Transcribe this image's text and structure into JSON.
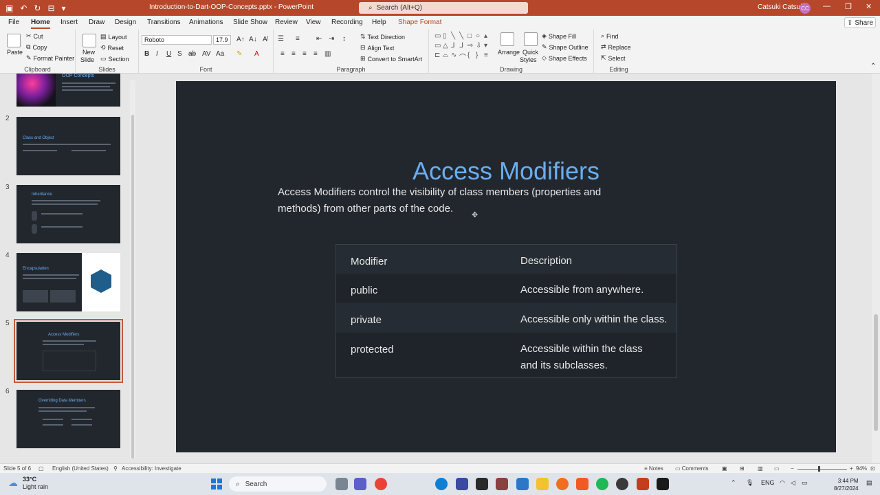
{
  "window": {
    "file_title": "Introduction-to-Dart-OOP-Concepts.pptx",
    "app_name": "PowerPoint",
    "search_placeholder": "Search (Alt+Q)",
    "user_name": "Catsuki Catsuki",
    "user_initials": "CC",
    "accent_color": "#b7472a"
  },
  "tabs": [
    "File",
    "Home",
    "Insert",
    "Draw",
    "Design",
    "Transitions",
    "Animations",
    "Slide Show",
    "Review",
    "View",
    "Recording",
    "Help",
    "Shape Format"
  ],
  "active_tab": "Home",
  "share_label": "Share",
  "ribbon": {
    "clipboard": {
      "label": "Clipboard",
      "paste": "Paste",
      "cut": "Cut",
      "copy": "Copy",
      "format_painter": "Format Painter"
    },
    "slides": {
      "label": "Slides",
      "new_slide": "New",
      "new_slide2": "Slide",
      "layout": "Layout",
      "reset": "Reset",
      "section": "Section"
    },
    "font": {
      "label": "Font",
      "font_name": "Roboto",
      "font_size": "17.9"
    },
    "paragraph": {
      "label": "Paragraph",
      "text_direction": "Text Direction",
      "align_text": "Align Text",
      "convert_smartart": "Convert to SmartArt"
    },
    "drawing": {
      "label": "Drawing",
      "arrange": "Arrange",
      "quick_styles": "Quick",
      "quick_styles2": "Styles",
      "shape_fill": "Shape Fill",
      "shape_outline": "Shape Outline",
      "shape_effects": "Shape Effects"
    },
    "editing": {
      "label": "Editing",
      "find": "Find",
      "replace": "Replace",
      "select": "Select"
    }
  },
  "thumbnails": [
    {
      "num": "",
      "title": "OOP Concepts"
    },
    {
      "num": "2",
      "title": "Class and Object"
    },
    {
      "num": "3",
      "title": "Inheritance"
    },
    {
      "num": "4",
      "title": "Encapsulation"
    },
    {
      "num": "5",
      "title": "Access Modifiers"
    },
    {
      "num": "6",
      "title": "Overriding Data Members"
    }
  ],
  "slide": {
    "title": "Access Modifiers",
    "body": "Access Modifiers control the visibility of class members (properties and methods) from other parts of the code.",
    "table": {
      "headers": [
        "Modifier",
        "Description"
      ],
      "rows": [
        [
          "public",
          "Accessible from anywhere."
        ],
        [
          "private",
          "Accessible only within the class."
        ],
        [
          "protected",
          "Accessible within the class and its subclasses."
        ]
      ]
    }
  },
  "status": {
    "slide_count": "Slide 5 of 6",
    "language": "English (United States)",
    "accessibility": "Accessibility: Investigate",
    "notes": "Notes",
    "comments": "Comments",
    "zoom": "94%"
  },
  "taskbar": {
    "temperature": "33°C",
    "weather": "Light rain",
    "search_label": "Search",
    "language": "ENG",
    "time": "3:44 PM",
    "date": "8/27/2024"
  }
}
